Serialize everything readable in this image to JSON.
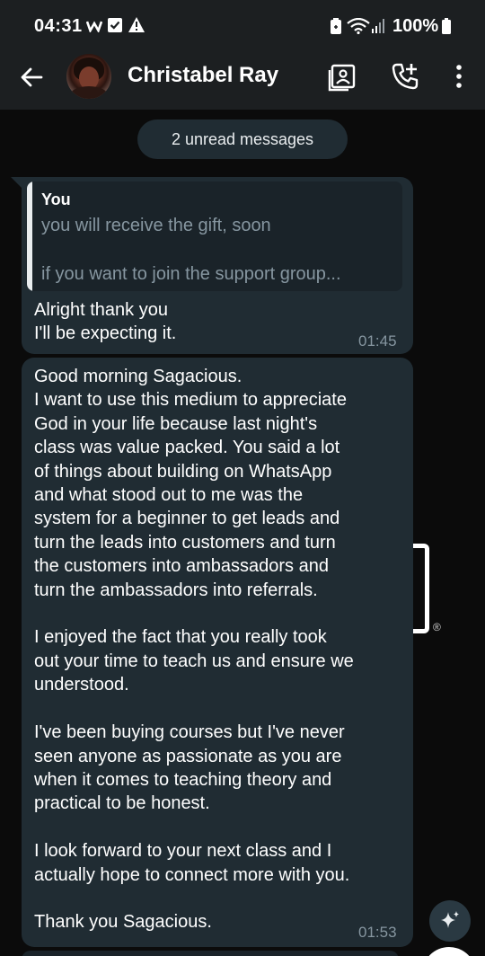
{
  "status_bar": {
    "time": "04:31",
    "left_icons": [
      "w-icon",
      "checkbox-icon",
      "warning-icon"
    ],
    "right_icons": [
      "battery-saver-icon",
      "wifi-icon",
      "signal-icon"
    ],
    "battery": "100%"
  },
  "app_bar": {
    "contact_name": "Christabel Ray",
    "icons": [
      "back-arrow-icon",
      "contact-card-icon",
      "add-call-icon",
      "more-vert-icon"
    ]
  },
  "unread_banner": "2 unread messages",
  "messages": [
    {
      "quoted_author": "You",
      "quoted_line_1": "you will receive the gift, soon",
      "quoted_line_2": "if you want to join the support group...",
      "text": "Alright thank you\nI'll be expecting it.",
      "time": "01:45"
    },
    {
      "text": "Good morning Sagacious.\nI want to use this medium to appreciate\nGod in your life because last night's\nclass was value packed. You said a lot\nof things about building on WhatsApp\nand what stood out to me was the\nsystem for a beginner to get leads and\nturn the leads into customers and turn\nthe customers into ambassadors and\nturn the ambassadors into referrals.\n\nI enjoyed the fact that you really took\nout your time to teach us and ensure we\nunderstood.\n\nI've been buying courses but I've never\nseen anyone as passionate as you are\nwhen it comes to teaching theory and\npractical to be honest.\n\nI look forward to your next class and I\nactually hope to connect more with you.\n\nThank you Sagacious.",
      "time": "01:53"
    }
  ],
  "background": {
    "registered_mark": "®"
  },
  "colors": {
    "bubble": "#202c33",
    "bar": "#1c1f21",
    "background": "#0b0b0b",
    "timestamp": "#8696a0"
  }
}
